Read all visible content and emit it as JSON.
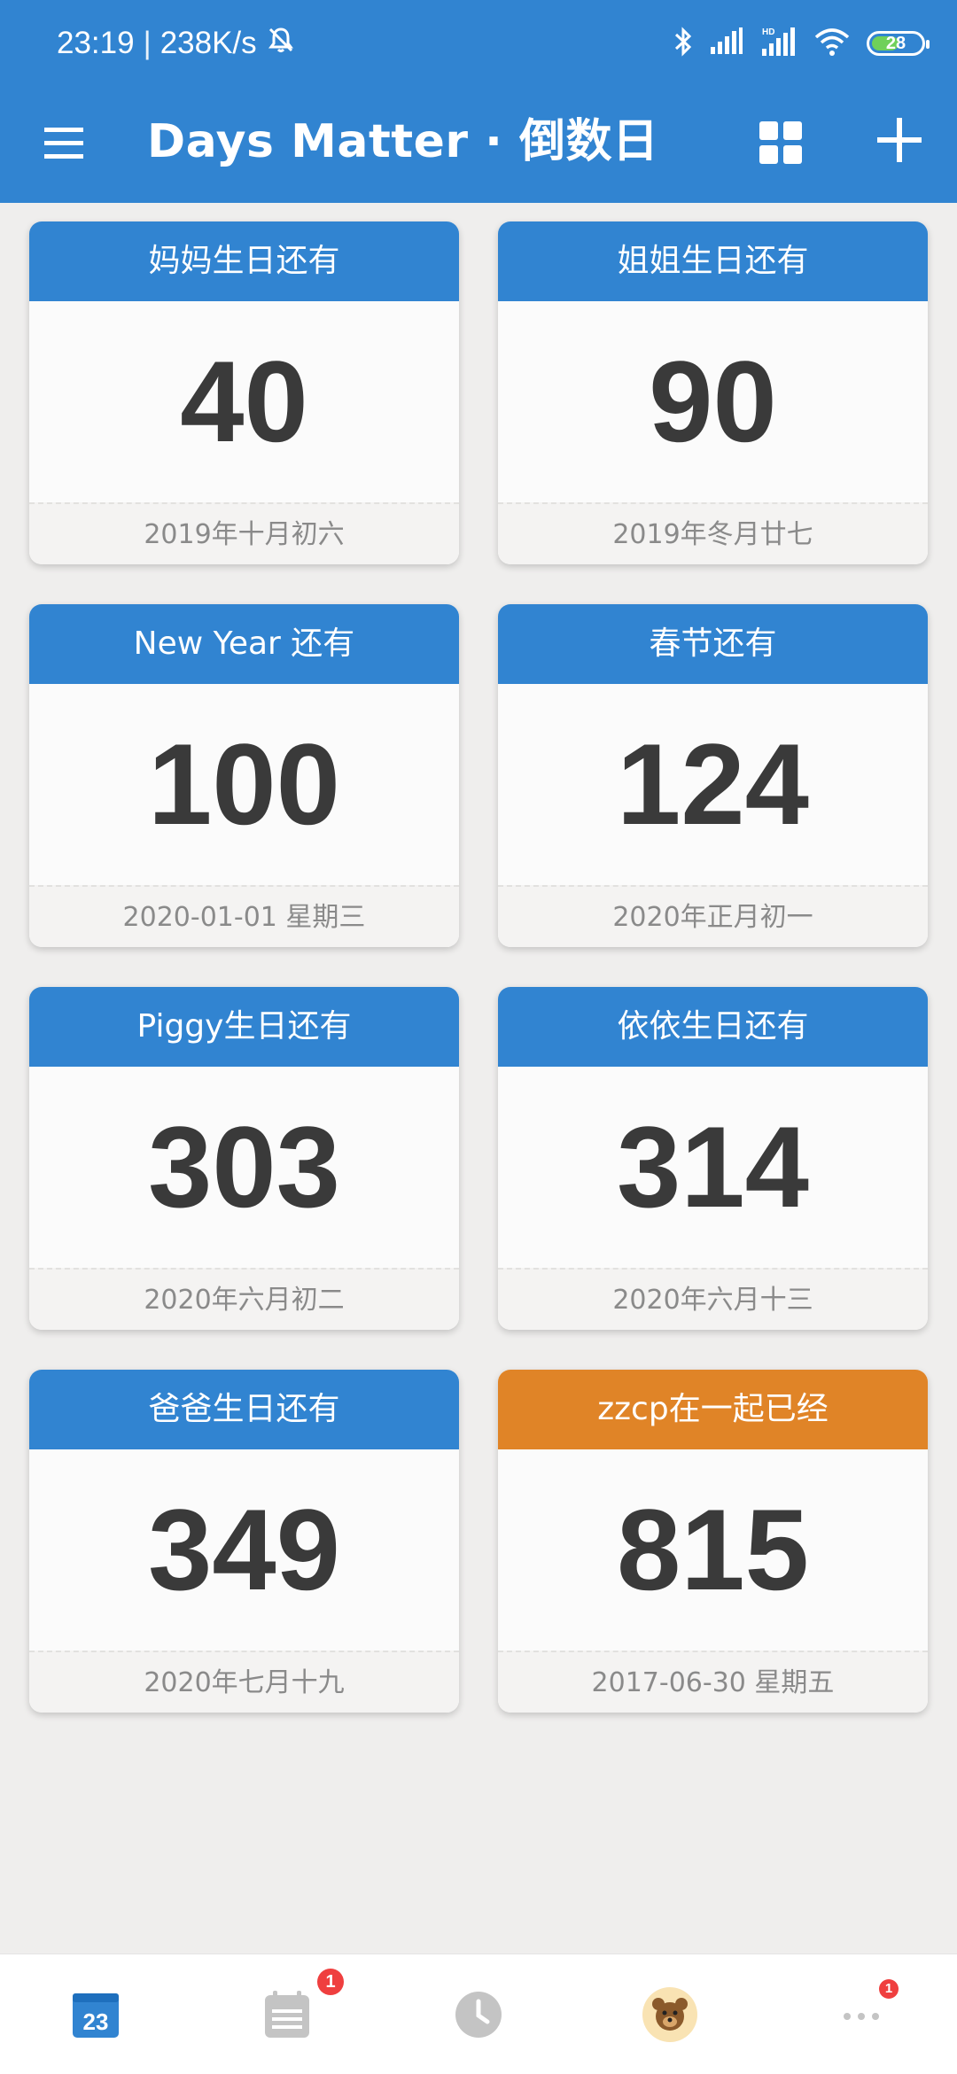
{
  "status_bar": {
    "time": "23:19",
    "separator": "|",
    "speed": "238K/s",
    "battery": "28"
  },
  "app_bar": {
    "title": "Days Matter · 倒数日"
  },
  "colors": {
    "primary": "#3184d1",
    "accent_orange": "#e08427",
    "badge_red": "#ef3f3f"
  },
  "cards": [
    {
      "title": "妈妈生日还有",
      "days": "40",
      "date": "2019年十月初六",
      "color": "#3184d1"
    },
    {
      "title": "姐姐生日还有",
      "days": "90",
      "date": "2019年冬月廿七",
      "color": "#3184d1"
    },
    {
      "title": "New Year 还有",
      "days": "100",
      "date": "2020-01-01 星期三",
      "color": "#3184d1"
    },
    {
      "title": "春节还有",
      "days": "124",
      "date": "2020年正月初一",
      "color": "#3184d1"
    },
    {
      "title": "Piggy生日还有",
      "days": "303",
      "date": "2020年六月初二",
      "color": "#3184d1"
    },
    {
      "title": "依依生日还有",
      "days": "314",
      "date": "2020年六月十三",
      "color": "#3184d1"
    },
    {
      "title": "爸爸生日还有",
      "days": "349",
      "date": "2020年七月十九",
      "color": "#3184d1"
    },
    {
      "title": "zzcp在一起已经",
      "days": "815",
      "date": "2017-06-30 星期五",
      "color": "#e08427"
    }
  ],
  "bottom_nav": {
    "calendar_day": "23",
    "list_badge": "1",
    "more_badge": "1"
  }
}
